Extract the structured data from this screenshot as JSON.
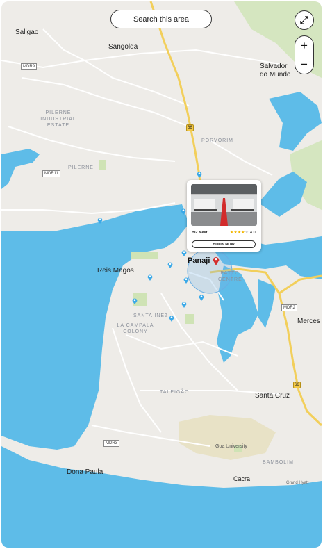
{
  "search_area_label": "Search this area",
  "controls": {
    "expand_icon": "expand-icon",
    "zoom_in": "+",
    "zoom_out": "−"
  },
  "places": {
    "saligao": "Saligao",
    "sangolda": "Sangolda",
    "salvador": "Salvador do Mundo",
    "pilerne_ie": "PILERNE INDUSTRIAL ESTATE",
    "pilerne": "PILERNE",
    "porvorim": "PORVORIM",
    "panaji": "Panaji",
    "patto": "PATTO CENTRE",
    "reis_magos": "Reis Magos",
    "santa_inez": "SANTA INEZ",
    "la_campala": "LA CAMPALA COLONY",
    "mercees": "Merces",
    "taleigao": "TALEIGÃO",
    "santa_cruz": "Santa Cruz",
    "goa_university": "Goa University",
    "bambolim": "BAMBOLIM",
    "dona_paula": "Dona Paula",
    "cacra": "Cacra",
    "grand_hyatt": "Grand Hyatt"
  },
  "road_labels": {
    "mdr9": "MDR9",
    "mdr11": "MDR11",
    "mdr2": "MDR2",
    "mdr3": "MDR3",
    "nh66": "66"
  },
  "popup": {
    "name": "BIZ Nest",
    "rating": "4.0",
    "rating_value": 4,
    "rating_max": 5,
    "book_label": "BOOK NOW"
  },
  "colors": {
    "water": "#5ebce8",
    "land": "#eeece8",
    "park": "#cfe3b5",
    "highway": "#f2cf5b",
    "pin": "#3aa9e8",
    "selected_pin": "#d32f2f"
  }
}
